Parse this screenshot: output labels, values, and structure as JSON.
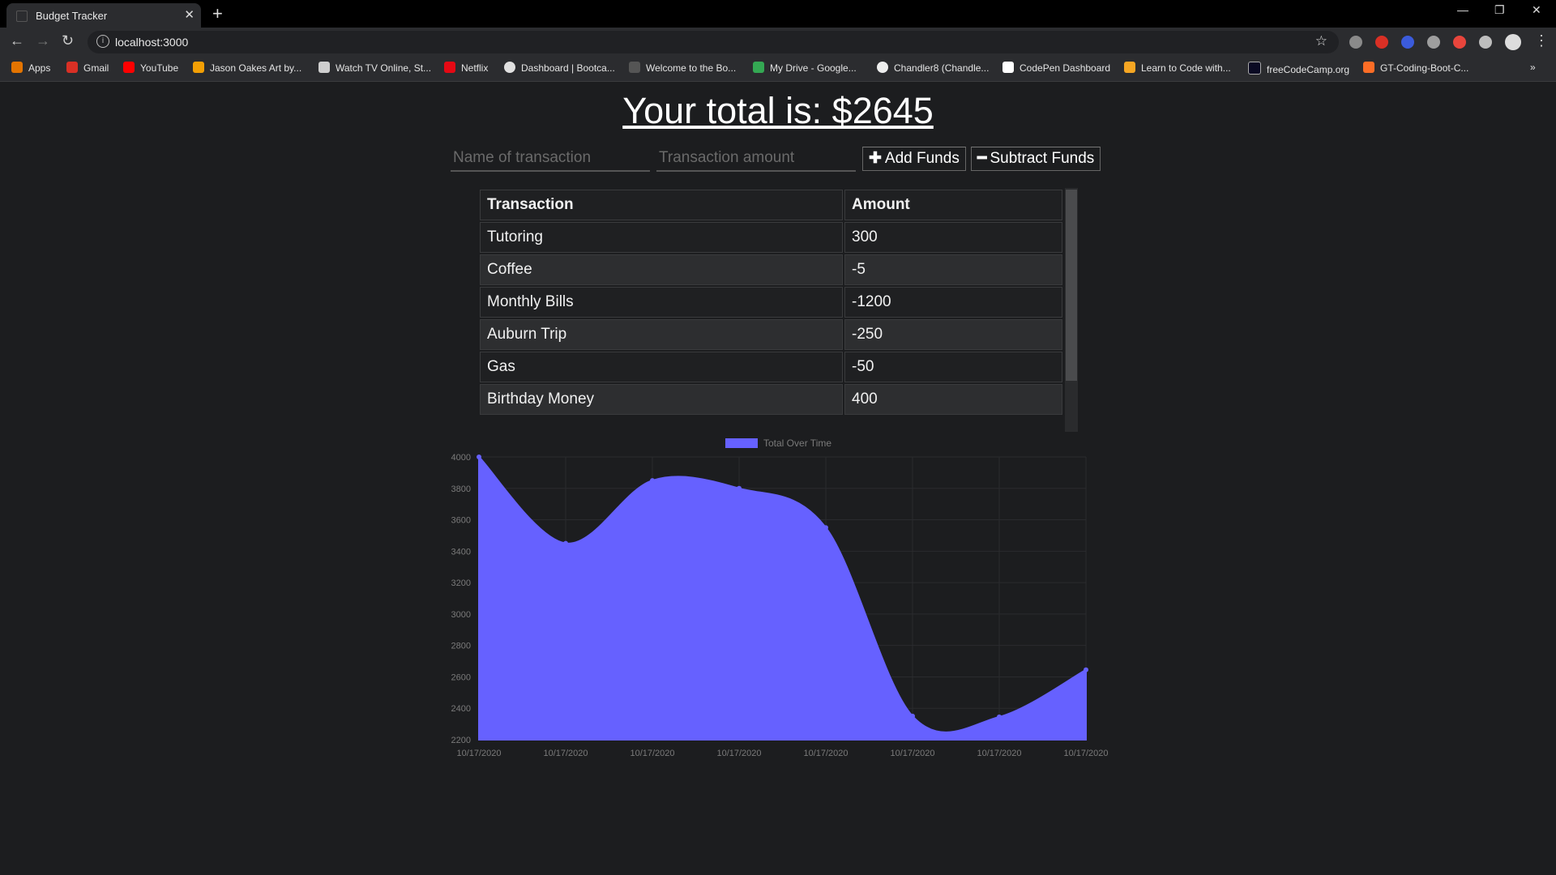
{
  "browser": {
    "tab_title": "Budget Tracker",
    "url": "localhost:3000",
    "bookmarks": [
      "Apps",
      "Gmail",
      "YouTube",
      "Jason Oakes Art by...",
      "Watch TV Online, St...",
      "Netflix",
      "Dashboard | Bootca...",
      "Welcome to the Bo...",
      "My Drive - Google...",
      "Chandler8 (Chandle...",
      "CodePen Dashboard",
      "Learn to Code with...",
      "freeCodeCamp.org",
      "GT-Coding-Boot-C..."
    ]
  },
  "page": {
    "total_text": "Your total is: $2645",
    "name_placeholder": "Name of transaction",
    "amount_placeholder": "Transaction amount",
    "add_label": "Add Funds",
    "subtract_label": "Subtract Funds"
  },
  "table": {
    "headers": [
      "Transaction",
      "Amount"
    ],
    "rows": [
      [
        "Tutoring",
        "300"
      ],
      [
        "Coffee",
        "-5"
      ],
      [
        "Monthly Bills",
        "-1200"
      ],
      [
        "Auburn Trip",
        "-250"
      ],
      [
        "Gas",
        "-50"
      ],
      [
        "Birthday Money",
        "400"
      ]
    ]
  },
  "chart_data": {
    "type": "area",
    "legend": [
      "Total Over Time"
    ],
    "color": "#6661ff",
    "x": [
      "10/17/2020",
      "10/17/2020",
      "10/17/2020",
      "10/17/2020",
      "10/17/2020",
      "10/17/2020",
      "10/17/2020",
      "10/17/2020"
    ],
    "series": [
      {
        "name": "Total Over Time",
        "values": [
          4000,
          3450,
          3850,
          3800,
          3550,
          2350,
          2345,
          2645
        ]
      }
    ],
    "ylim": [
      2200,
      4000
    ],
    "yticks": [
      4000,
      3800,
      3600,
      3400,
      3200,
      3000,
      2800,
      2600,
      2400,
      2200
    ],
    "grid": true
  }
}
